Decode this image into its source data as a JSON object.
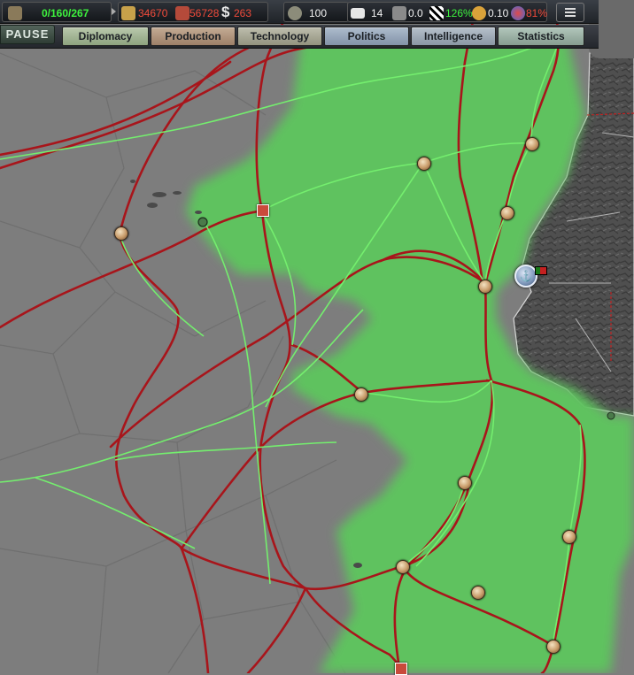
{
  "topbar": {
    "manpower": "0/160/267",
    "energy": "34670",
    "metal": "56728",
    "money": "263",
    "officers": "100",
    "diplomats": "14",
    "espionage": "0.0",
    "dissent_pct": "126%",
    "nukes": "0.10",
    "national_unity": "81%"
  },
  "status": {
    "pause_label": "PAUSE"
  },
  "tabs": [
    {
      "label": "Diplomacy",
      "color": "#a8b89a"
    },
    {
      "label": "Production",
      "color": "#b49a84"
    },
    {
      "label": "Technology",
      "color": "#a9a99a"
    },
    {
      "label": "Politics",
      "color": "#9aa8b9"
    },
    {
      "label": "Intelligence",
      "color": "#a3aeb8"
    },
    {
      "label": "Statistics",
      "color": "#9fb3a8"
    }
  ],
  "colors": {
    "sea": "#7d7d7d",
    "territory": "#5ec25e",
    "land": "#4e4e4e",
    "trade_route": "#a8151b",
    "supply_line": "#74ee6e",
    "value_green": "#3df23d",
    "value_red": "#f04a3a",
    "value_white": "#f2f2f2"
  }
}
